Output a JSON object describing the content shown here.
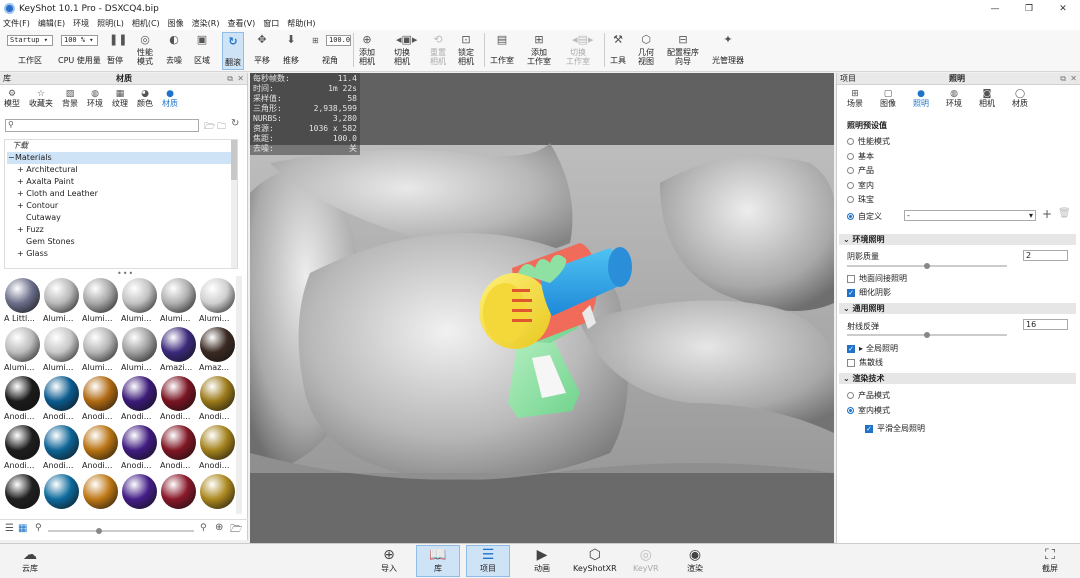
{
  "window": {
    "title": "KeyShot 10.1 Pro - DSXCQ4.bip",
    "minimize": "—",
    "maximize": "❐",
    "close": "✕"
  },
  "menu": [
    "文件(F)",
    "编辑(E)",
    "环境",
    "照明(L)",
    "相机(C)",
    "图像",
    "渲染(R)",
    "查看(V)",
    "窗口",
    "帮助(H)"
  ],
  "toolbar": {
    "workspace_select": "Startup",
    "workspace_label": "工作区",
    "cpu_select": "100 %",
    "cpu_label": "CPU 使用量",
    "pause": "暂停",
    "perf_line1": "性能",
    "perf_line2": "模式",
    "denoise": "去噪",
    "region": "区域",
    "tumble": "翻滚",
    "pan": "平移",
    "dolly": "推移",
    "fov_value": "100.0",
    "view": "视角",
    "add_camera_l1": "添加",
    "add_camera_l2": "相机",
    "switch_camera_l1": "切换",
    "switch_camera_l2": "相机",
    "reset_camera_l1": "重置",
    "reset_camera_l2": "相机",
    "lock_camera_l1": "锁定",
    "lock_camera_l2": "相机",
    "studio": "工作室",
    "add_studio_l1": "添加",
    "add_studio_l2": "工作室",
    "switch_studio_l1": "切换",
    "switch_studio_l2": "工作室",
    "tools": "工具",
    "geometry_l1": "几何",
    "geometry_l2": "视图",
    "config_l1": "配置程序",
    "config_l2": "向导",
    "light_manager": "光管理器"
  },
  "library": {
    "header": "库",
    "title": "材质",
    "tabs": [
      "模型",
      "收藏夹",
      "背景",
      "环境",
      "纹理",
      "颜色",
      "材质"
    ],
    "active_tab": "材质",
    "search_placeholder": "",
    "tree": [
      {
        "label": "下载",
        "indent": 0
      },
      {
        "label": "Materials",
        "indent": 0
      },
      {
        "label": "Architectural",
        "indent": 1
      },
      {
        "label": "Axalta Paint",
        "indent": 1
      },
      {
        "label": "Cloth and Leather",
        "indent": 1
      },
      {
        "label": "Contour",
        "indent": 1
      },
      {
        "label": "Cutaway",
        "indent": 1
      },
      {
        "label": "Fuzz",
        "indent": 1
      },
      {
        "label": "Gem Stones",
        "indent": 1
      },
      {
        "label": "Glass",
        "indent": 1
      }
    ],
    "swatches": [
      {
        "label": "A Littl...",
        "color": "#6b6f8a"
      },
      {
        "label": "Alumi...",
        "color": "#b9b9b9"
      },
      {
        "label": "Alumi...",
        "color": "#a8a8a8"
      },
      {
        "label": "Alumi...",
        "color": "#c3c3c3"
      },
      {
        "label": "Alumi...",
        "color": "#b0b0b0"
      },
      {
        "label": "Alumi...",
        "color": "#d0d0d0"
      },
      {
        "label": "Alumi...",
        "color": "#bdbdbd"
      },
      {
        "label": "Alumi...",
        "color": "#c8c8c8"
      },
      {
        "label": "Alumi...",
        "color": "#b5b5b5"
      },
      {
        "label": "Alumi...",
        "color": "#a0a0a0"
      },
      {
        "label": "Amazi...",
        "color": "#3c2a7c"
      },
      {
        "label": "Amaz...",
        "color": "#3a2a22"
      },
      {
        "label": "Anodi...",
        "color": "#1b1b1b"
      },
      {
        "label": "Anodi...",
        "color": "#0b5b8f"
      },
      {
        "label": "Anodi...",
        "color": "#b06a12"
      },
      {
        "label": "Anodi...",
        "color": "#3b1a78"
      },
      {
        "label": "Anodi...",
        "color": "#7a1422"
      },
      {
        "label": "Anodi...",
        "color": "#9c7a1a"
      },
      {
        "label": "Anodi...",
        "color": "#1e1e1e"
      },
      {
        "label": "Anodi...",
        "color": "#0c6496"
      },
      {
        "label": "Anodi...",
        "color": "#b87312"
      },
      {
        "label": "Anodi...",
        "color": "#401c80"
      },
      {
        "label": "Anodi...",
        "color": "#801624"
      },
      {
        "label": "Anodi...",
        "color": "#a4821c"
      },
      {
        "label": "",
        "color": "#202020"
      },
      {
        "label": "",
        "color": "#0d6a9d"
      },
      {
        "label": "",
        "color": "#bf7815"
      },
      {
        "label": "",
        "color": "#441e88"
      },
      {
        "label": "",
        "color": "#88182a"
      },
      {
        "label": "",
        "color": "#ab881e"
      }
    ]
  },
  "stats": [
    {
      "k": "每秒帧数:",
      "v": "11.4"
    },
    {
      "k": "时间:",
      "v": "1m 22s"
    },
    {
      "k": "采样值:",
      "v": "58"
    },
    {
      "k": "三角形:",
      "v": "2,938,599"
    },
    {
      "k": "NURBS:",
      "v": "3,280"
    },
    {
      "k": "资源:",
      "v": "1036 x 582"
    },
    {
      "k": "焦距:",
      "v": "100.0"
    },
    {
      "k": "去噪:",
      "v": "关"
    }
  ],
  "project": {
    "header": "项目",
    "title": "照明",
    "tabs": [
      "场景",
      "图像",
      "照明",
      "环境",
      "相机",
      "材质"
    ],
    "active_tab": "照明",
    "presets_title": "照明预设值",
    "presets": [
      "性能模式",
      "基本",
      "产品",
      "室内",
      "珠宝",
      "自定义"
    ],
    "selected_preset": "自定义",
    "custom_select_value": "-",
    "env_section": "环境照明",
    "shadow_quality_label": "阴影质量",
    "shadow_quality_value": "2",
    "shadow_quality_fraction": 0.5,
    "ground_indirect": "地面间接照明",
    "refine_shadows": "细化阴影",
    "general_section": "通用照明",
    "ray_bounces_label": "射线反弹",
    "ray_bounces_value": "16",
    "ray_bounces_fraction": 0.5,
    "global_illum": "全局照明",
    "caustics": "焦散线",
    "render_section": "渲染技术",
    "tech_options": [
      "产品模式",
      "室内模式"
    ],
    "selected_tech": "室内模式",
    "smooth_gi": "平滑全局照明"
  },
  "bottom": {
    "cloud": "云库",
    "import": "导入",
    "library": "库",
    "project": "项目",
    "animation": "动画",
    "keyshotxr": "KeyShotXR",
    "keyvr": "KeyVR",
    "render": "渲染",
    "screenshot": "截屏"
  }
}
